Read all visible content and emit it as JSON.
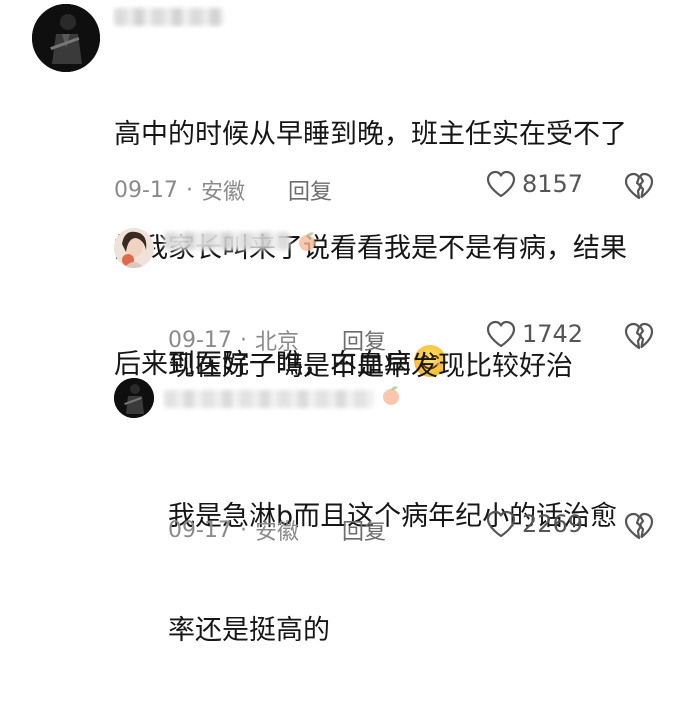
{
  "comments": [
    {
      "text_lines": [
        "高中的时候从早睡到晚，班主任实在受不了",
        "把我家长叫来了说看看我是不是有病，结果",
        "后来到医院一瞧，白血病"
      ],
      "date": "09-17",
      "location": "安徽",
      "reply_label": "回复",
      "likes": "8157",
      "has_emoji": true
    },
    {
      "text_lines": [
        "现在好了吗是不是早发现比较好治"
      ],
      "date": "09-17",
      "location": "北京",
      "reply_label": "回复",
      "likes": "1742"
    },
    {
      "text_lines": [
        "我是急淋b而且这个病年纪小的话治愈",
        "率还是挺高的"
      ],
      "date": "09-17",
      "location": "安徽",
      "reply_label": "回复",
      "likes": "2269"
    }
  ],
  "icons": {
    "like": "heart-outline-icon",
    "dislike": "broken-heart-icon",
    "emoji": "smiling-face-emoji"
  },
  "colors": {
    "text": "#161616",
    "meta": "#8a8a8a",
    "icon": "#555555"
  }
}
